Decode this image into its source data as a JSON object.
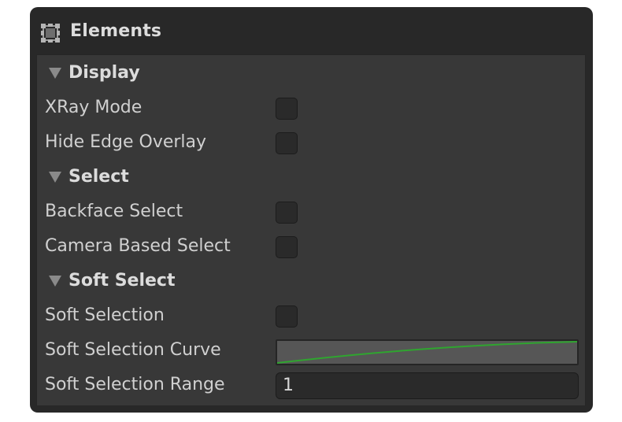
{
  "panel": {
    "title": "Elements",
    "icon": "elements-grid-icon"
  },
  "sections": {
    "display": {
      "label": "Display",
      "expanded": true,
      "fields": {
        "xray_mode": {
          "label": "XRay Mode",
          "checked": false
        },
        "hide_edge_overlay": {
          "label": "Hide Edge Overlay",
          "checked": false
        }
      }
    },
    "select": {
      "label": "Select",
      "expanded": true,
      "fields": {
        "backface_select": {
          "label": "Backface Select",
          "checked": false
        },
        "camera_based_select": {
          "label": "Camera Based Select",
          "checked": false
        }
      }
    },
    "soft_select": {
      "label": "Soft Select",
      "expanded": true,
      "fields": {
        "soft_selection": {
          "label": "Soft Selection",
          "checked": false
        },
        "soft_selection_curve": {
          "label": "Soft Selection Curve"
        },
        "soft_selection_range": {
          "label": "Soft Selection Range",
          "value": "1"
        }
      }
    }
  },
  "colors": {
    "panel_bg": "#282828",
    "content_bg": "#383838",
    "curve_line": "#2fa52f",
    "text": "#d0d0d0"
  }
}
